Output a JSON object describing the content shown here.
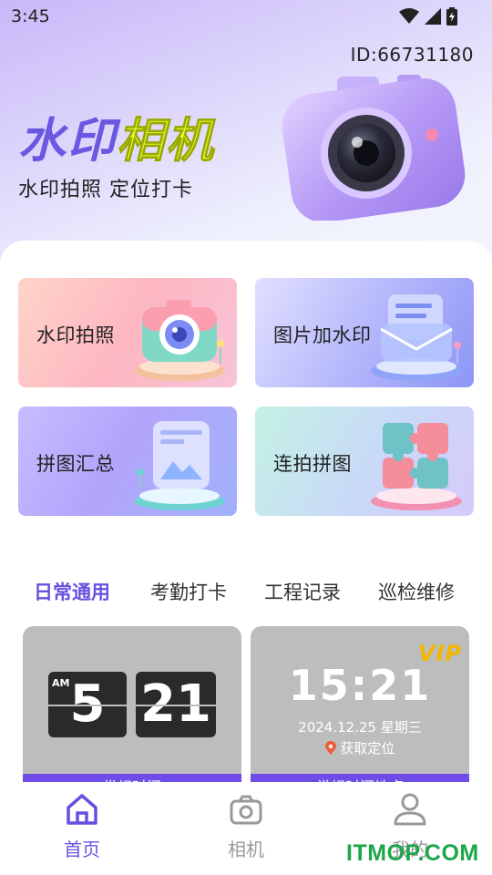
{
  "status_bar": {
    "time": "3:45",
    "icons": [
      "wifi-icon",
      "signal-icon",
      "battery-icon"
    ]
  },
  "header": {
    "user_id": "ID:66731180",
    "title_part1": "水印",
    "title_part2": "相机",
    "subtitle": "水印拍照  定位打卡",
    "camera_illustration": "purple-camera"
  },
  "features": [
    {
      "label": "水印拍照",
      "icon": "camera-3d-icon"
    },
    {
      "label": "图片加水印",
      "icon": "photo-watermark-3d-icon"
    },
    {
      "label": "拼图汇总",
      "icon": "collage-3d-icon"
    },
    {
      "label": "连拍拼图",
      "icon": "puzzle-3d-icon"
    }
  ],
  "tabs": [
    {
      "label": "日常通用",
      "active": true
    },
    {
      "label": "考勤打卡",
      "active": false
    },
    {
      "label": "工程记录",
      "active": false
    },
    {
      "label": "巡检维修",
      "active": false
    }
  ],
  "templates": [
    {
      "am": "AM",
      "hour": "5",
      "minute": "21",
      "footer": "常规时间"
    },
    {
      "badge": "VIP",
      "time": "15:21",
      "date": "2024.12.25  星期三",
      "location": "获取定位",
      "footer": "常规时间地点"
    }
  ],
  "nav": [
    {
      "label": "首页",
      "icon": "home-icon",
      "active": true
    },
    {
      "label": "相机",
      "icon": "camera-icon",
      "active": false
    },
    {
      "label": "我的",
      "icon": "user-icon",
      "active": false
    }
  ],
  "watermark": "ITMOP.COM",
  "colors": {
    "accent": "#6a4fe0",
    "title_yellow": "#e8ff3a",
    "vip_gold": "#f2b800",
    "watermark_green": "#1da64a"
  }
}
